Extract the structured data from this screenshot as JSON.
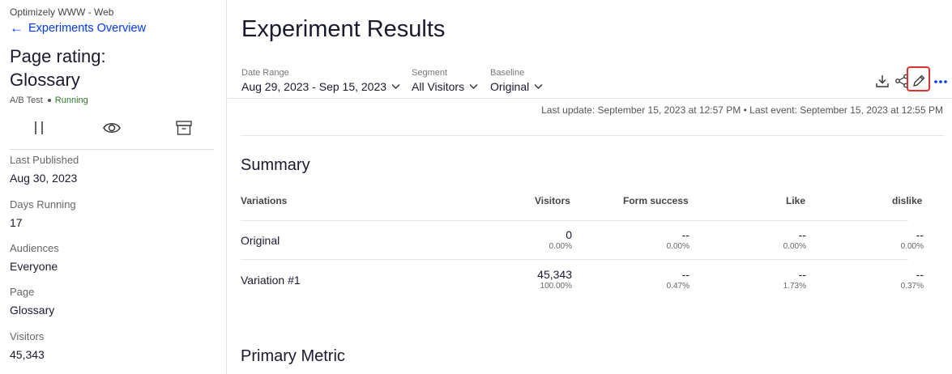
{
  "sidebar": {
    "project": "Optimizely WWW - Web",
    "back_link": "Experiments Overview",
    "title_line1": "Page rating:",
    "title_line2": "Glossary",
    "experiment_type": "A/B Test",
    "status": "Running",
    "actions": [
      {
        "name": "pause-icon"
      },
      {
        "name": "preview-eye-icon"
      },
      {
        "name": "archive-icon"
      }
    ],
    "meta": [
      {
        "label": "Last Published",
        "value": "Aug 30, 2023"
      },
      {
        "label": "Days Running",
        "value": "17"
      },
      {
        "label": "Audiences",
        "value": "Everyone"
      },
      {
        "label": "Page",
        "value": "Glossary"
      },
      {
        "label": "Visitors",
        "value": "45,343"
      }
    ]
  },
  "main": {
    "heading": "Experiment Results",
    "filters": {
      "date_range": {
        "label": "Date Range",
        "value": "Aug 29, 2023 - Sep 15, 2023"
      },
      "segment": {
        "label": "Segment",
        "value": "All Visitors"
      },
      "baseline": {
        "label": "Baseline",
        "value": "Original"
      }
    },
    "toolbar": [
      "download-icon",
      "share-icon",
      "edit-pencil-icon",
      "more-icon"
    ],
    "last_update": "Last update: September 15, 2023 at 12:57 PM • Last event: September 15, 2023 at 12:55 PM",
    "summary_title": "Summary",
    "table": {
      "headers": [
        "Variations",
        "Visitors",
        "Form success",
        "Like",
        "dislike"
      ],
      "rows": [
        {
          "name": "Original",
          "visitors": "0",
          "visitors_pct": "0.00%",
          "form_success": "--",
          "form_success_pct": "0.00%",
          "like": "--",
          "like_pct": "0.00%",
          "dislike": "--",
          "dislike_pct": "0.00%"
        },
        {
          "name": "Variation #1",
          "visitors": "45,343",
          "visitors_pct": "100.00%",
          "form_success": "--",
          "form_success_pct": "0.47%",
          "like": "--",
          "like_pct": "1.73%",
          "dislike": "--",
          "dislike_pct": "0.37%"
        }
      ]
    },
    "primary_metric_title": "Primary Metric"
  },
  "colors": {
    "link": "#0037ff",
    "highlight": "#e03131",
    "status_running": "#2c7a2c"
  }
}
